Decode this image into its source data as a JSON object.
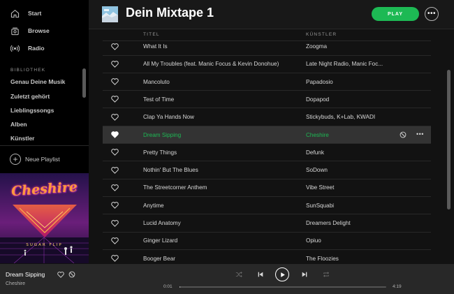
{
  "sidebar": {
    "nav": [
      {
        "label": "Start",
        "icon": "home-icon"
      },
      {
        "label": "Browse",
        "icon": "browse-icon"
      },
      {
        "label": "Radio",
        "icon": "radio-icon"
      }
    ],
    "library_heading": "BIBLIOTHEK",
    "library_items": [
      "Genau Deine Musik",
      "Zuletzt gehört",
      "Lieblingssongs",
      "Alben",
      "Künstler"
    ],
    "new_playlist": "Neue Playlist",
    "cover_art": {
      "artist_text": "Cheshire",
      "album_text": "SUGAR FLIP"
    }
  },
  "header": {
    "title": "Dein Mixtape 1",
    "play_label": "PLAY",
    "more_label": "•••"
  },
  "table": {
    "columns": {
      "title": "TITEL",
      "artist": "KÜNSTLER"
    },
    "rows": [
      {
        "title": "What It Is",
        "artist": "Zoogma"
      },
      {
        "title": "All My Troubles (feat. Manic Focus & Kevin Donohue)",
        "artist": "Late Night Radio, Manic Foc..."
      },
      {
        "title": "Mancoluto",
        "artist": "Papadosio"
      },
      {
        "title": "Test of Time",
        "artist": "Dopapod"
      },
      {
        "title": "Clap Ya Hands Now",
        "artist": "Stickybuds, K+Lab, KWADI"
      },
      {
        "title": "Dream Sipping",
        "artist": "Cheshire",
        "active": true
      },
      {
        "title": "Pretty Things",
        "artist": "Defunk"
      },
      {
        "title": "Nothin' But The Blues",
        "artist": "SoDown"
      },
      {
        "title": "The Streetcorner Anthem",
        "artist": "Vibe Street"
      },
      {
        "title": "Anytime",
        "artist": "SunSquabi"
      },
      {
        "title": "Lucid Anatomy",
        "artist": "Dreamers Delight"
      },
      {
        "title": "Ginger Lizard",
        "artist": "Opiuo"
      },
      {
        "title": "Booger Bear",
        "artist": "The Floozies"
      }
    ],
    "row_more_label": "•••"
  },
  "player": {
    "title": "Dream Sipping",
    "artist": "Cheshire",
    "elapsed": "0:01",
    "duration": "4:19",
    "progress": 0.004
  },
  "colors": {
    "accent": "#1db954",
    "sidebar_bg": "#000000",
    "main_bg": "#121212",
    "player_bg": "#282828",
    "active_row_bg": "#333333"
  }
}
